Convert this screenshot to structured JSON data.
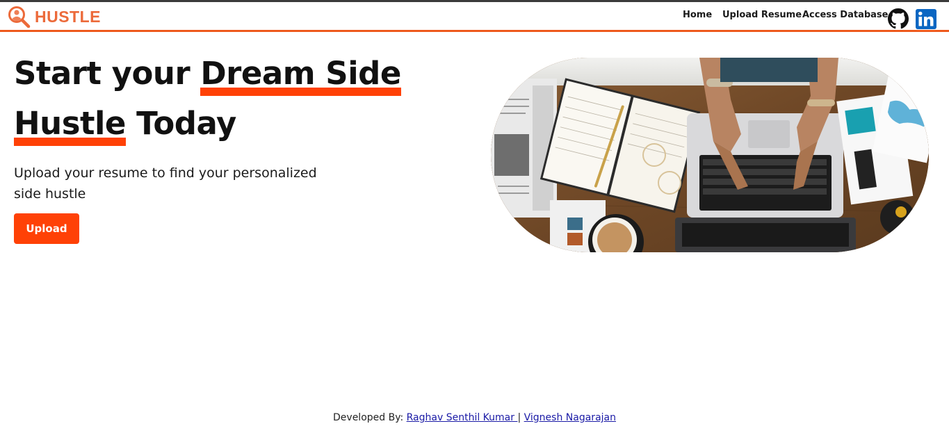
{
  "brand": {
    "name": "HUSTLE",
    "icon": "search-user-icon",
    "color": "#ec6a3a"
  },
  "nav": {
    "items": [
      {
        "label": "Home"
      },
      {
        "label": "Upload Resume"
      },
      {
        "label": "Access Database"
      }
    ],
    "social": [
      {
        "icon": "github-icon"
      },
      {
        "icon": "linkedin-icon"
      }
    ]
  },
  "hero": {
    "title_part1": "Start your ",
    "title_highlight1": "Dream Side",
    "title_highlight2": "Hustle",
    "title_part2": " Today",
    "subtitle": "Upload your resume to find your personalized side hustle",
    "button_label": "Upload",
    "accent": "#ff4106"
  },
  "footer": {
    "prefix": "Developed By: ",
    "authors": [
      "Raghav Senthil Kumar ",
      "Vignesh Nagarajan"
    ],
    "separator": " | "
  }
}
